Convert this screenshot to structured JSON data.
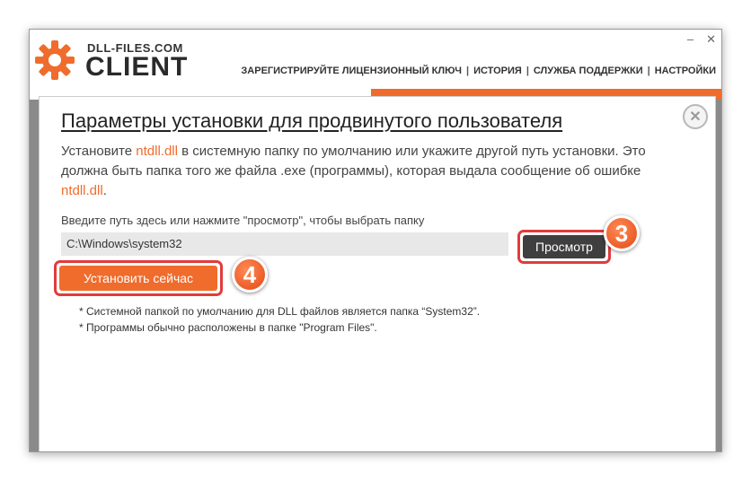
{
  "app": {
    "brand_small": "DLL-FILES.COM",
    "brand_big": "CLIENT",
    "logo_icon": "gear-icon",
    "accent_color": "#ef6c2c"
  },
  "window_controls": {
    "minimize": "–",
    "close": "✕"
  },
  "nav": {
    "register": "ЗАРЕГИСТРИРУЙТЕ ЛИЦЕНЗИОННЫЙ КЛЮЧ",
    "history": "ИСТОРИЯ",
    "support": "СЛУЖБА ПОДДЕРЖКИ",
    "settings": "НАСТРОЙКИ",
    "separator": "|"
  },
  "dialog": {
    "title": "Параметры установки для продвинутого пользователя",
    "close_icon": "close-icon",
    "desc_part1": "Установите ",
    "dll_name": "ntdll.dll",
    "desc_part2": " в системную папку по умолчанию или укажите другой путь установки. Это должна быть папка того же файла .exe (программы), которая выдала сообщение об ошибке ",
    "desc_part3": ".",
    "path_label": "Введите путь здесь или нажмите \"просмотр\", чтобы выбрать папку",
    "path_value": "C:\\Windows\\system32",
    "browse_label": "Просмотр",
    "install_label": "Установить сейчас",
    "note1": "* Системной папкой по умолчанию для DLL файлов является папка “System32”.",
    "note2": "* Программы обычно расположены в папке \"Program Files\"."
  },
  "annotations": {
    "step_browse": "3",
    "step_install": "4"
  }
}
